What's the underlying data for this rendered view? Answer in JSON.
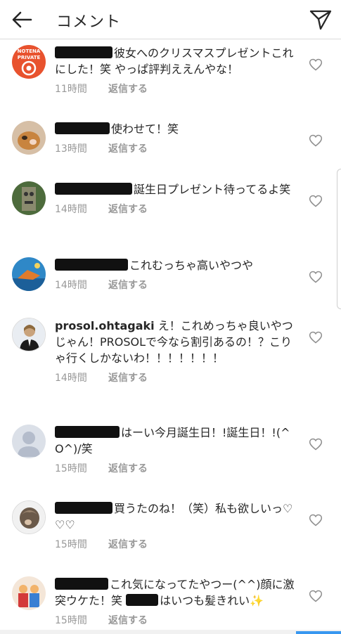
{
  "header": {
    "title": "コメント",
    "back_icon": "back-arrow-icon",
    "send_icon": "direct-send-icon"
  },
  "reply_label": "返信する",
  "colors": {
    "text": "#262626",
    "meta": "#999999",
    "accent": "#3897f0"
  },
  "comments": [
    {
      "username": "",
      "text": "彼女へのクリスマスプレゼントこれにした！笑 やっぱ評判ええんやな！",
      "time": "11時間",
      "avatar": "avatar-notena-private",
      "liked": false
    },
    {
      "username": "",
      "text": "使わせて！笑",
      "time": "13時間",
      "avatar": "avatar-dog",
      "liked": false
    },
    {
      "username": "",
      "text": "誕生日プレゼント待ってるよ笑",
      "time": "14時間",
      "avatar": "avatar-tiki-statue",
      "liked": false
    },
    {
      "username": "",
      "text": "これむっちゃ高いやつや",
      "time": "14時間",
      "avatar": "avatar-sea-bird",
      "liked": false
    },
    {
      "username": "prosol.ohtagaki",
      "text": "え！これめっちゃ良いやつじゃん！PROSOLで今なら割引あるの！？こりゃ行くしかないわ！！！！！！！",
      "time": "14時間",
      "avatar": "avatar-person-photo",
      "liked": false
    },
    {
      "username": "",
      "text": "はーい今月誕生日！!誕生日！!(^O^)/笑",
      "time": "15時間",
      "avatar": "avatar-default-silhouette",
      "liked": false
    },
    {
      "username": "",
      "text": "買うたのね！（笑）私も欲しいっ♡♡♡",
      "time": "15時間",
      "avatar": "avatar-hair-style",
      "liked": false
    },
    {
      "username": "",
      "text": "これ気になってたやつー(^^)顔に激突ウケた！笑",
      "text2": "はいつも髪きれい",
      "time": "15時間",
      "avatar": "avatar-kids-costume",
      "liked": false
    }
  ]
}
